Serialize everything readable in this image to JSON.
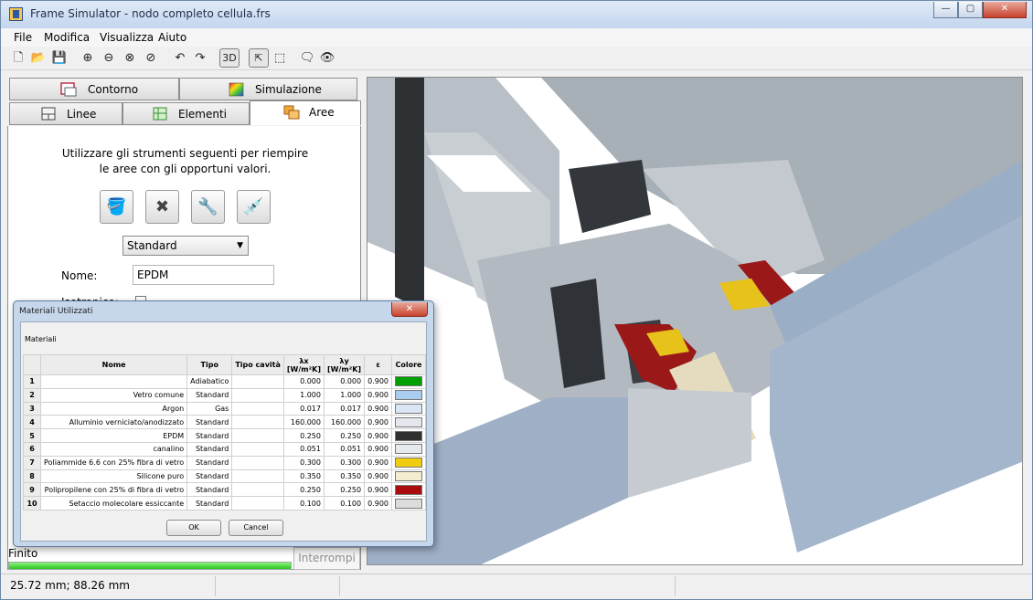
{
  "window": {
    "title": "Frame Simulator - nodo completo cellula.frs",
    "controls": {
      "minimize": "—",
      "maximize": "▢",
      "close": "✕"
    }
  },
  "menu": [
    {
      "label": "File"
    },
    {
      "label": "Modifica"
    },
    {
      "label": "Visualizza"
    },
    {
      "label": "Aiuto"
    }
  ],
  "toolbar": {
    "mode_3d": "3D",
    "icons": [
      "new-file-icon",
      "open-folder-icon",
      "save-icon",
      "zoom-in-icon",
      "zoom-out-icon",
      "zoom-window-icon",
      "zoom-fit-icon",
      "undo-icon",
      "redo-icon",
      "3d-view-icon",
      "select-arrow-icon",
      "select-area-icon",
      "comment-icon",
      "eye-icon"
    ]
  },
  "tabs": {
    "row1": [
      {
        "label": "Contorno",
        "icon": "contour-icon"
      },
      {
        "label": "Simulazione",
        "icon": "simulation-icon"
      }
    ],
    "row2": [
      {
        "label": "Linee",
        "icon": "lines-icon"
      },
      {
        "label": "Elementi",
        "icon": "elements-icon"
      },
      {
        "label": "Aree",
        "icon": "areas-icon",
        "active": true
      }
    ]
  },
  "areas_panel": {
    "instruction_line1": "Utilizzare gli strumenti seguenti per riempire",
    "instruction_line2": "le aree con gli opportuni valori.",
    "tools": [
      "paint-bucket-icon",
      "erase-fill-icon",
      "fill-tool-icon",
      "eyedropper-icon"
    ],
    "type_select": "Standard",
    "nome_label": "Nome:",
    "nome_value": "EPDM",
    "isotropico_label": "Isotropico:"
  },
  "status": {
    "text": "Finito",
    "progress": 1.0,
    "interrompi": "Interrompi",
    "coords": "25.72 mm; 88.26 mm"
  },
  "dialog": {
    "title": "Materiali Utilizzati",
    "group_label": "Materiali",
    "close": "✕",
    "columns": {
      "nome": "Nome",
      "tipo": "Tipo",
      "tipo_cavita": "Tipo cavità",
      "lx": "λx",
      "lx_unit": "[W/m²K]",
      "ly": "λy",
      "ly_unit": "[W/m²K]",
      "eps": "ε",
      "colore": "Colore"
    },
    "rows": [
      {
        "n": "1",
        "nome": "",
        "tipo": "Adiabatico",
        "cav": "",
        "lx": "0.000",
        "ly": "0.000",
        "eps": "0.900",
        "color": "#00a000"
      },
      {
        "n": "2",
        "nome": "Vetro comune",
        "tipo": "Standard",
        "cav": "",
        "lx": "1.000",
        "ly": "1.000",
        "eps": "0.900",
        "color": "#a9cdee"
      },
      {
        "n": "3",
        "nome": "Argon",
        "tipo": "Gas",
        "cav": "",
        "lx": "0.017",
        "ly": "0.017",
        "eps": "0.900",
        "color": "#dbe6f4"
      },
      {
        "n": "4",
        "nome": "Alluminio verniciato/anodizzato",
        "tipo": "Standard",
        "cav": "",
        "lx": "160.000",
        "ly": "160.000",
        "eps": "0.900",
        "color": "#e4e8ee"
      },
      {
        "n": "5",
        "nome": "EPDM",
        "tipo": "Standard",
        "cav": "",
        "lx": "0.250",
        "ly": "0.250",
        "eps": "0.900",
        "color": "#303030"
      },
      {
        "n": "6",
        "nome": "canalino",
        "tipo": "Standard",
        "cav": "",
        "lx": "0.051",
        "ly": "0.051",
        "eps": "0.900",
        "color": "#e6eaef"
      },
      {
        "n": "7",
        "nome": "Poliammide 6.6 con 25% fibra di vetro",
        "tipo": "Standard",
        "cav": "",
        "lx": "0.300",
        "ly": "0.300",
        "eps": "0.900",
        "color": "#f2cc10"
      },
      {
        "n": "8",
        "nome": "Silicone puro",
        "tipo": "Standard",
        "cav": "",
        "lx": "0.350",
        "ly": "0.350",
        "eps": "0.900",
        "color": "#f2eecf"
      },
      {
        "n": "9",
        "nome": "Polipropilene con 25% di fibra di vetro",
        "tipo": "Standard",
        "cav": "",
        "lx": "0.250",
        "ly": "0.250",
        "eps": "0.900",
        "color": "#a80c0c"
      },
      {
        "n": "10",
        "nome": "Setaccio molecolare essiccante",
        "tipo": "Standard",
        "cav": "",
        "lx": "0.100",
        "ly": "0.100",
        "eps": "0.900",
        "color": "#dcdcdc"
      }
    ],
    "ok": "OK",
    "cancel": "Cancel"
  },
  "colors": {
    "accent": "#2cc51e",
    "title_bar": "#c3d6ee",
    "close_button": "#c7422c"
  }
}
